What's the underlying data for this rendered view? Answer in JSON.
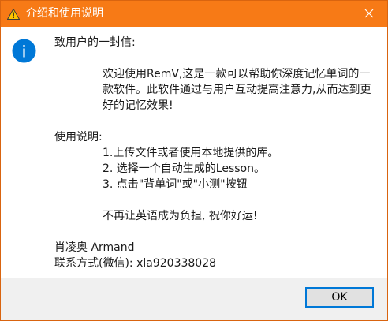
{
  "window": {
    "title": "介绍和使用说明",
    "icons": {
      "app": "warning-triangle-icon",
      "close": "close-icon",
      "info": "info-icon"
    },
    "colors": {
      "titlebar": "#f77a16",
      "info_icon": "#0078d7",
      "ok_border": "#0078d7"
    }
  },
  "message": {
    "greeting": "致用户的一封信:",
    "intro": "欢迎使用RemV,这是一款可以帮助你深度记忆单词的一款软件。此软件通过与用户互动提高注意力,从而达到更好的记忆效果!",
    "usage_heading": "使用说明:",
    "steps": [
      "1.上传文件或者使用本地提供的库。",
      "2. 选择一个自动生成的Lesson。",
      "3. 点击\"背单词\"或\"小测\"按钮"
    ],
    "wish": "不再让英语成为负担, 祝你好运!",
    "author": "肖凌奥 Armand",
    "contact": "联系方式(微信): xla920338028"
  },
  "buttons": {
    "ok_label": "OK"
  }
}
